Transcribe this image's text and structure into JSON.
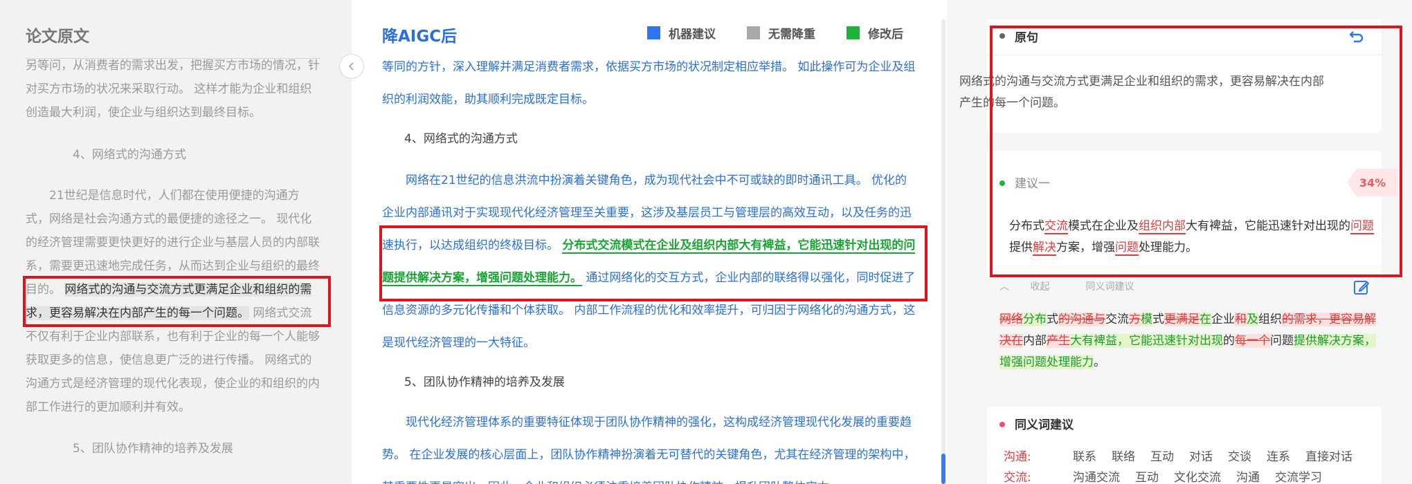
{
  "left": {
    "title": "论文原文",
    "p1": "另等问，从消费者的需求出发，把握买方市场的情况，针对买方市场的状况来采取行动。 这样才能为企业和组织创造最大利润，使企业与组织达到最终目标。",
    "heading4": "4、网络式的沟通方式",
    "p2_pre": "21世纪是信息时代，人们都在使用便捷的沟通方式，网络是社会沟通方式的最便捷的途径之一。 现代化的经济管理需要更快更好的进行企业与基层人员的内部联系，需要更迅速地完成任务，从而达到企业与组织的最终目的。 ",
    "p2_highlight": "网络式的沟通与交流方式更满足企业和组织的需求，更容易解决在内部产生的每一个问题。",
    "p2_post": " 网络式交流不仅有利于企业内部联系，也有利于企业的每一个人能够获取更多的信息，使信息更广泛的进行传播。 网络式的沟通方式是经济管理的现代化表现，使企业的和组织的内部工作进行的更加顺利并有效。",
    "heading5": "5、团队协作精神的培养及发展"
  },
  "collapse_icon": "chevron-left-icon",
  "middle": {
    "title": "降AIGC后",
    "legend": [
      {
        "label": "机器建议",
        "color": "#2f74f0"
      },
      {
        "label": "无需降重",
        "color": "#a8a8a8"
      },
      {
        "label": "修改后",
        "color": "#1fb33a"
      }
    ],
    "p1": "等同的方针，深入理解并满足消费者需求，依据买方市场的状况制定相应举措。 如此操作可为企业及组织的利润效能，助其顺利完成既定目标。",
    "heading4": "4、网络式的沟通方式",
    "p2_pre": "网络在21世纪的信息洪流中扮演着关键角色，成为现代社会中不可或缺的即时通讯工具。 优化的企业内部通讯对于实现现代化经济管理至关重要，这涉及基层员工与管理层的高效互动，以及任务的迅速执行，以达成组织的终极目标。 ",
    "p2_green": "分布式交流模式在企业及组织内部大有裨益，它能迅速针对出现的问题提供解决方案，增强问题处理能力。",
    "p2_post": " 通过网络化的交互方式，企业内部的联络得以强化，同时促进了信息资源的多元化传播和个体获取。 内部工作流程的优化和效率提升，可归因于网络化的沟通方式，这是现代经济管理的一大特征。",
    "heading5": "5、团队协作精神的培养及发展",
    "p3": "现代化经济管理体系的重要特征体现于团队协作精神的强化，这构成经济管理现代化发展的重要趋势。 在企业发展的核心层面上，团队协作精神扮演着无可替代的关键角色，尤其在经济管理的架构中，其重要性更显突出。因此，企业和组织必须注重培养团队协作精神，提升团队整体实力。"
  },
  "right": {
    "original_label": "原句",
    "undo_icon": "undo-icon",
    "original_text": "网络式的沟通与交流方式更满足企业和组织的需求，更容易解决在内部产生的每一个问题。",
    "suggestion_label": "建议一",
    "suggestion_pct": "34%",
    "suggestion_parts": [
      {
        "t": "分布式",
        "u": false
      },
      {
        "t": "交流",
        "u": true
      },
      {
        "t": "模式在企业及",
        "u": false
      },
      {
        "t": "组织内部",
        "u": true
      },
      {
        "t": "大有裨益，它能迅速针对出现的",
        "u": false
      },
      {
        "t": "问题",
        "u": true
      },
      {
        "t": "提供",
        "u": false
      },
      {
        "t": "解决",
        "u": true
      },
      {
        "t": "方案，增强",
        "u": false
      },
      {
        "t": "问题",
        "u": true
      },
      {
        "t": "处理能力。",
        "u": false
      }
    ],
    "collapse_label": "收起",
    "synonym_tab_label": "同义词建议",
    "edit_icon": "edit-icon",
    "diff_parts": [
      {
        "t": "网络",
        "k": "del"
      },
      {
        "t": "分布",
        "k": "add"
      },
      {
        "t": "式",
        "k": "same"
      },
      {
        "t": "的沟通与",
        "k": "del"
      },
      {
        "t": "交流",
        "k": "same"
      },
      {
        "t": "方",
        "k": "del"
      },
      {
        "t": "模",
        "k": "add"
      },
      {
        "t": "式",
        "k": "same"
      },
      {
        "t": "更满足",
        "k": "del"
      },
      {
        "t": "在",
        "k": "add"
      },
      {
        "t": "企业",
        "k": "same"
      },
      {
        "t": "和",
        "k": "del"
      },
      {
        "t": "及",
        "k": "add"
      },
      {
        "t": "组织",
        "k": "same"
      },
      {
        "t": "的需求，更容易解决在",
        "k": "del"
      },
      {
        "t": "内部",
        "k": "same"
      },
      {
        "t": "产生",
        "k": "del"
      },
      {
        "t": "大有裨益，它能迅速针对出现",
        "k": "add"
      },
      {
        "t": "的",
        "k": "same"
      },
      {
        "t": "每一个",
        "k": "del"
      },
      {
        "t": "问题",
        "k": "same"
      },
      {
        "t": "提供解决方案，增强问题处理能力",
        "k": "add"
      },
      {
        "t": "。",
        "k": "same"
      }
    ],
    "synonym_title": "同义词建议",
    "synonyms": [
      {
        "key": "沟通:",
        "items": [
          "联系",
          "联络",
          "互动",
          "对话",
          "交谈",
          "连系",
          "直接对话"
        ]
      },
      {
        "key": "交流:",
        "items": [
          "沟通交流",
          "互动",
          "文化交流",
          "沟通",
          "交流学习"
        ]
      }
    ]
  }
}
